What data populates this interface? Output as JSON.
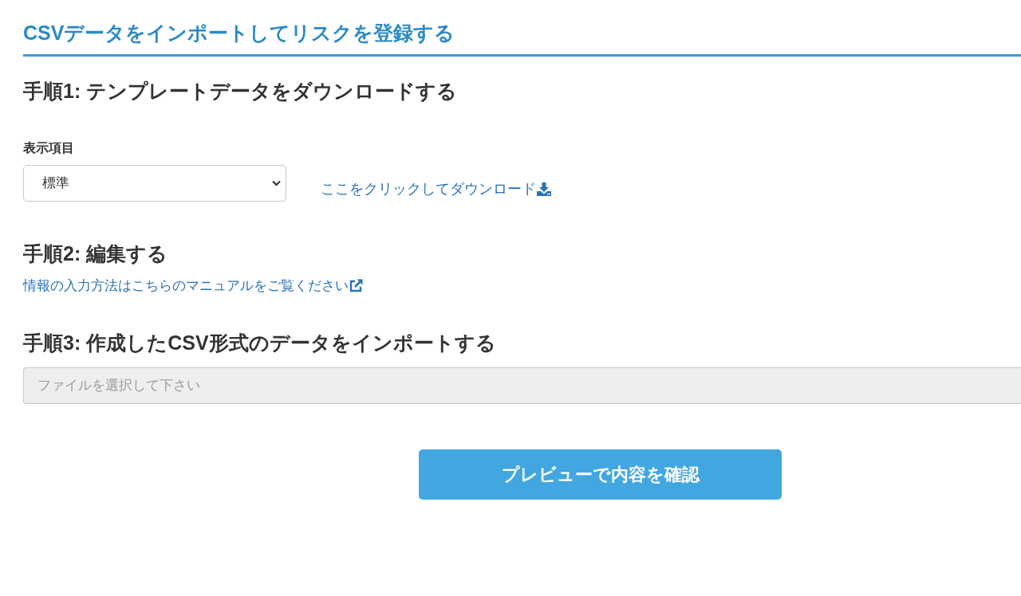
{
  "page_title": "CSVデータをインポートしてリスクを登録する",
  "step1": {
    "heading": "手順1: テンプレートデータをダウンロードする",
    "select": {
      "label": "表示項目",
      "value": "標準"
    },
    "download_link": "ここをクリックしてダウンロード"
  },
  "step2": {
    "heading": "手順2: 編集する",
    "manual_link": "情報の入力方法はこちらのマニュアルをご覧ください"
  },
  "step3": {
    "heading": "手順3: 作成したCSV形式のデータをインポートする",
    "file_field": {
      "placeholder": "ファイルを選択して下さい",
      "disabled": true
    }
  },
  "preview_button": "プレビューで内容を確認"
}
